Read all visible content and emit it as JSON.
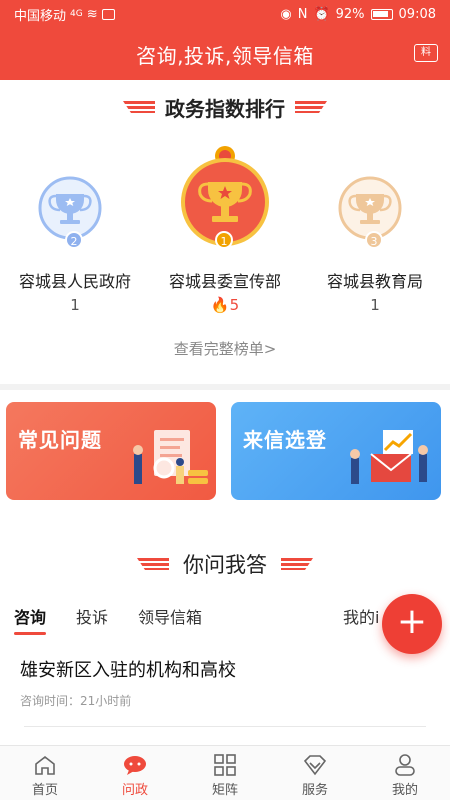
{
  "status_bar": {
    "carrier": "中国移动",
    "signal": "4G",
    "battery": "92%",
    "time": "09:08"
  },
  "header": {
    "title": "咨询,投诉,领导信箱",
    "icon": "newspaper-icon"
  },
  "ranking": {
    "title": "政务指数排行",
    "items": [
      {
        "rank": "2",
        "name": "容城县人民政府",
        "score": "1"
      },
      {
        "rank": "1",
        "name": "容城县委宣传部",
        "score": "5"
      },
      {
        "rank": "3",
        "name": "容城县教育局",
        "score": "1"
      }
    ],
    "more": "查看完整榜单>"
  },
  "cards": {
    "faq": "常见问题",
    "selected_letters": "来信选登"
  },
  "qa": {
    "title": "你问我答",
    "tabs": [
      "咨询",
      "投诉",
      "领导信箱"
    ],
    "my_label": "我的i"
  },
  "list": [
    {
      "title": "雄安新区入驻的机构和高校",
      "time": "咨询时间：21小时前"
    }
  ],
  "nav": [
    "首页",
    "问政",
    "矩阵",
    "服务",
    "我的"
  ],
  "colors": {
    "primary": "#ef4a3c",
    "blue": "#3f96ee",
    "gold": "#f2a200"
  }
}
